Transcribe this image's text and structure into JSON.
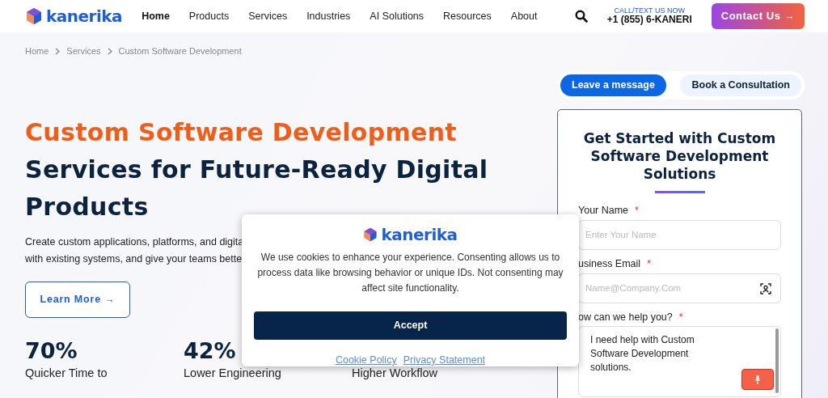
{
  "header": {
    "logo": "kanerika",
    "nav": [
      {
        "label": "Home",
        "selected": true
      },
      {
        "label": "Products",
        "selected": false
      },
      {
        "label": "Services",
        "selected": false
      },
      {
        "label": "Industries",
        "selected": false
      },
      {
        "label": "AI Solutions",
        "selected": false
      },
      {
        "label": "Resources",
        "selected": false
      },
      {
        "label": "About",
        "selected": false
      }
    ],
    "call_label": "CALL/TEXT US NOW",
    "phone": "+1 (855) 6-KANERI",
    "contact_button": "Contact Us →"
  },
  "breadcrumb": [
    "Home",
    "Services",
    "Custom Software Development"
  ],
  "hero": {
    "title_highlight": "Custom Software Development",
    "title_rest": "Services for Future-Ready Digital Products",
    "description_lines": [
      "Create custom applications, platforms, and digita",
      "with existing systems, and give your teams bette"
    ],
    "button": "Learn More →",
    "stats": [
      {
        "value": "70%",
        "label": "Quicker Time to"
      },
      {
        "value": "42%",
        "label": "Lower Engineering"
      },
      {
        "label": "Higher Workflow"
      }
    ]
  },
  "form": {
    "tabs": [
      {
        "label": "Leave a message",
        "selected": true
      },
      {
        "label": "Book a Consultation",
        "selected": false
      }
    ],
    "title": "Get Started with Custom Software Development Solutions",
    "fields": [
      {
        "kind": "text",
        "label": "Your Name",
        "required_mark": "*",
        "placeholder": "Enter Your Name"
      },
      {
        "kind": "email",
        "label": "usiness Email",
        "required_mark": "*",
        "placeholder": "Name@Company.Com"
      },
      {
        "kind": "textarea",
        "label": "ow can we help you?",
        "required_mark": "*",
        "value": "I need help with Custom Software Development solutions."
      }
    ]
  },
  "cookie_banner": {
    "logo": "kanerika",
    "message": "We use cookies to enhance your experience. Consenting allows us to process data like browsing behavior or unique IDs. Not consenting may affect site functionality.",
    "accept": "Accept",
    "links": [
      "Cookie Policy",
      "Privacy Statement"
    ]
  }
}
